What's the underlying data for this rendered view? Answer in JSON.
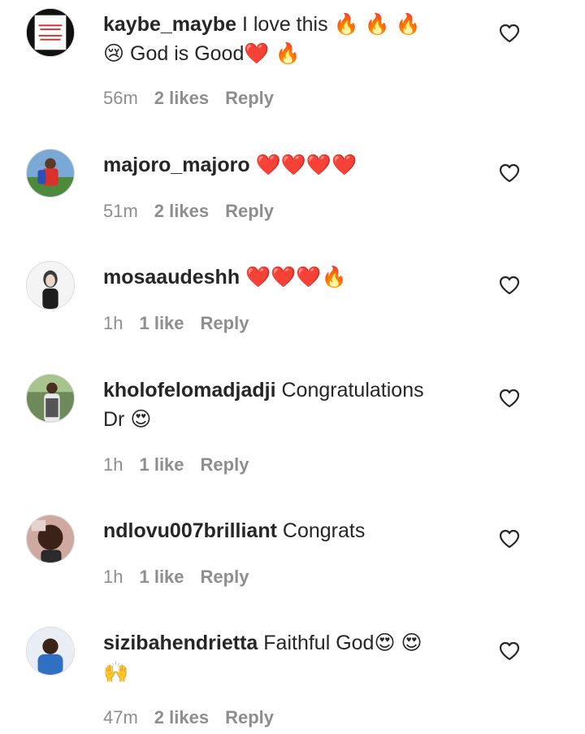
{
  "comments": [
    {
      "username": "kaybe_maybe",
      "text_line1": "I love this 🔥 🔥 🔥",
      "text_line2": "😢  God is Good❤️ 🔥",
      "time": "56m",
      "likes": "2 likes",
      "reply": "Reply"
    },
    {
      "username": "majoro_majoro",
      "text_line1": "❤️❤️❤️❤️",
      "text_line2": "",
      "time": "51m",
      "likes": "2 likes",
      "reply": "Reply"
    },
    {
      "username": "mosaaudeshh",
      "text_line1": "❤️❤️❤️🔥",
      "text_line2": "",
      "time": "1h",
      "likes": "1 like",
      "reply": "Reply"
    },
    {
      "username": "kholofelomadjadji",
      "text_line1": "Congratulations",
      "text_line2": "Dr 😍",
      "time": "1h",
      "likes": "1 like",
      "reply": "Reply"
    },
    {
      "username": "ndlovu007brilliant",
      "text_line1": "Congrats",
      "text_line2": "",
      "time": "1h",
      "likes": "1 like",
      "reply": "Reply"
    },
    {
      "username": "sizibahendrietta",
      "text_line1": "Faithful God😍 😍",
      "text_line2": "🙌",
      "time": "47m",
      "likes": "2 likes",
      "reply": "Reply"
    }
  ],
  "icons": {
    "like": "heart-outline-icon"
  },
  "colors": {
    "text": "#262626",
    "meta": "#8e8e8e",
    "background": "#ffffff"
  }
}
